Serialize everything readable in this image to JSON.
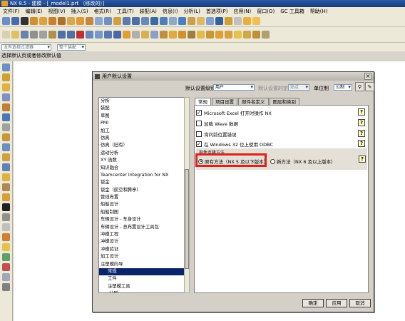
{
  "window": {
    "title": "NX 8.5 - 建模 - [_model1.prt （修改的）]"
  },
  "menu": [
    "文件(F)",
    "编辑(E)",
    "视图(V)",
    "插入(S)",
    "格式(R)",
    "工具(T)",
    "装配(A)",
    "信息(I)",
    "分析(L)",
    "首选项(P)",
    "应用(N)",
    "窗口(O)",
    "GC 工具箱",
    "帮助(H)"
  ],
  "selection": {
    "filter": "没有选择过滤器",
    "scope": "整个装配"
  },
  "cue_line": "选择默认页或者修改默认值",
  "dialog": {
    "title": "用户默认设置",
    "level_label": "默认设置级别",
    "level_value": "用户",
    "level_note": "默认设置的定义在",
    "level_note_value": "站点",
    "unit_label": "单位制",
    "unit_value": "公制",
    "tree": [
      {
        "label": "分析",
        "kind": "top"
      },
      {
        "label": "装配",
        "kind": "top"
      },
      {
        "label": "草图",
        "kind": "top"
      },
      {
        "label": "PMI",
        "kind": "top"
      },
      {
        "label": "加工",
        "kind": "top"
      },
      {
        "label": "仿真",
        "kind": "top"
      },
      {
        "label": "仿真（旧有）",
        "kind": "top"
      },
      {
        "label": "运动分析",
        "kind": "top"
      },
      {
        "label": "XY 函数",
        "kind": "top"
      },
      {
        "label": "知识融合",
        "kind": "top"
      },
      {
        "label": "Teamcenter Integration for NX",
        "kind": "top"
      },
      {
        "label": "钣金",
        "kind": "top"
      },
      {
        "label": "钣金（航空和腾亭）",
        "kind": "top"
      },
      {
        "label": "管线布置",
        "kind": "top"
      },
      {
        "label": "船舶设计",
        "kind": "top"
      },
      {
        "label": "船舶制图",
        "kind": "top"
      },
      {
        "label": "车辆设计 - 车身设计",
        "kind": "top"
      },
      {
        "label": "车辆设计 - 总布置设计工具包",
        "kind": "top"
      },
      {
        "label": "冲模工程",
        "kind": "top"
      },
      {
        "label": "冲模设计",
        "kind": "top"
      },
      {
        "label": "冲模验证",
        "kind": "top"
      },
      {
        "label": "加工设计",
        "kind": "top"
      },
      {
        "label": "注塑模向导",
        "kind": "top"
      },
      {
        "label": "常规",
        "kind": "child-selected"
      },
      {
        "label": "工件",
        "kind": "sub"
      },
      {
        "label": "注塑模工具",
        "kind": "sub"
      },
      {
        "label": "分型",
        "kind": "grandsub"
      }
    ],
    "tabs": [
      "常规",
      "项目设置",
      "部件名定义",
      "图层和类别"
    ],
    "options": [
      {
        "label": "Microsoft Excel 打开时操作 NX",
        "checked": true
      },
      {
        "label": "加载 Wave 数据",
        "checked": false
      },
      {
        "label": "询问前位置错误",
        "checked": false
      },
      {
        "label": "在 Windows 32 位上使用 ODBC",
        "checked": true
      }
    ],
    "group_label": "部件克隆方法",
    "radio_old": "原有方法（NX 5 及以下版本）",
    "radio_new": "新方法（NX 6 及以上版本）",
    "help_glyph": "?",
    "close_glyph": "×",
    "ok": "确定",
    "apply": "应用",
    "cancel": "取消"
  }
}
